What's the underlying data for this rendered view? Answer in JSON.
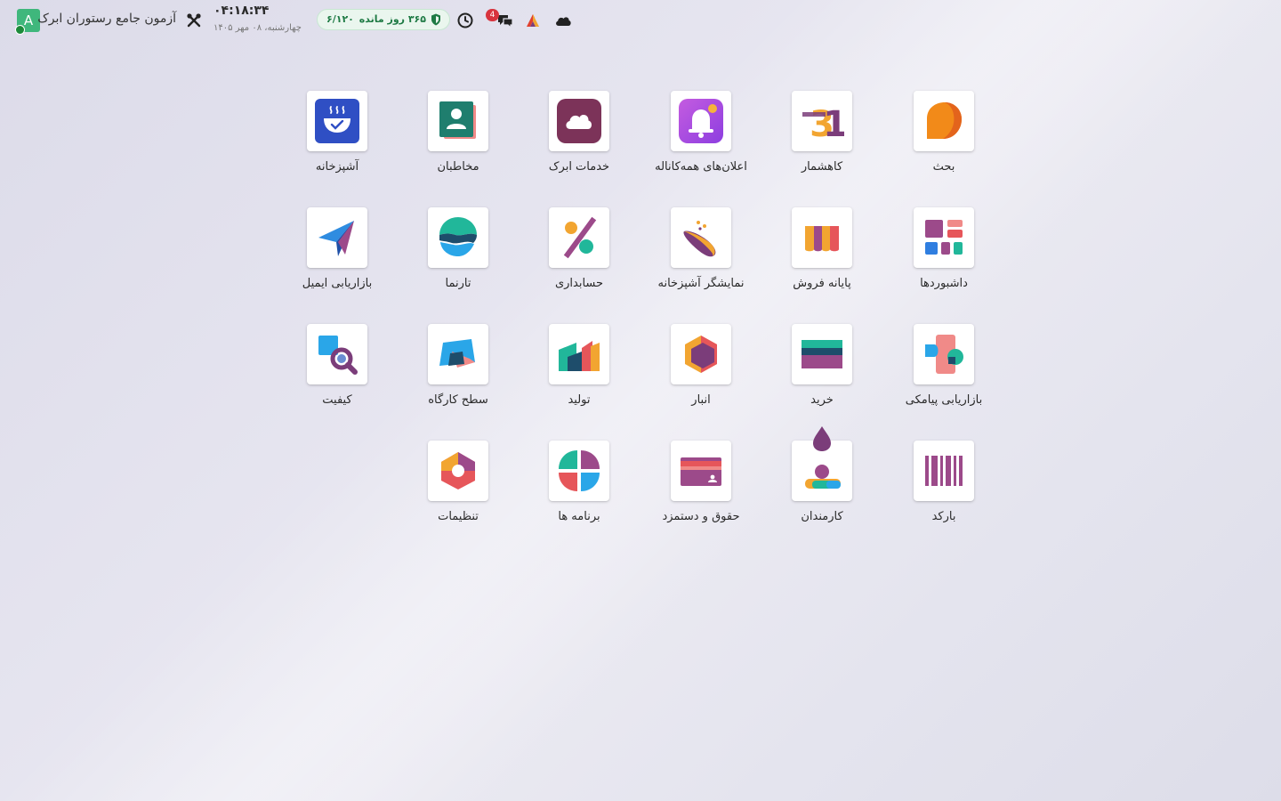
{
  "topbar": {
    "avatar_letter": "A",
    "company_name": "آزمون جامع رستوران ابرک",
    "clock_time": "۰۴:۱۸:۳۴",
    "clock_date": "چهارشنبه، ۰۸ مهر ۱۴۰۵",
    "subscription_days": "۳۶۵ روز مانده",
    "subscription_count": "۶/۱۲۰",
    "notification_count": "4",
    "icons": [
      "tools-icon",
      "shield-icon",
      "clock-icon",
      "chat-icon",
      "activity-logo-icon",
      "cloud-icon"
    ]
  },
  "apps": [
    {
      "label": "آشپزخانه",
      "icon": "kitchen-icon"
    },
    {
      "label": "مخاطبان",
      "icon": "contacts-icon"
    },
    {
      "label": "خدمات ابرک",
      "icon": "cloud-services-icon"
    },
    {
      "label": "اعلان‌های همه‌کاناله",
      "icon": "omnichannel-icon"
    },
    {
      "label": "کاهشمار",
      "icon": "calendar-icon"
    },
    {
      "label": "بحث",
      "icon": "discuss-icon"
    },
    {
      "label": "بازاریابی ایمیل",
      "icon": "email-marketing-icon"
    },
    {
      "label": "تارنما",
      "icon": "website-icon"
    },
    {
      "label": "حسابداری",
      "icon": "accounting-icon"
    },
    {
      "label": "نمایشگر آشپزخانه",
      "icon": "kitchen-display-icon"
    },
    {
      "label": "پایانه فروش",
      "icon": "pos-icon"
    },
    {
      "label": "داشبوردها",
      "icon": "dashboards-icon"
    },
    {
      "label": "کیفیت",
      "icon": "quality-icon"
    },
    {
      "label": "سطح کارگاه",
      "icon": "shop-floor-icon"
    },
    {
      "label": "تولید",
      "icon": "manufacturing-icon"
    },
    {
      "label": "انبار",
      "icon": "inventory-icon"
    },
    {
      "label": "خرید",
      "icon": "purchase-icon"
    },
    {
      "label": "بازاریابی پیامکی",
      "icon": "sms-marketing-icon"
    },
    {
      "label": "تنظیمات",
      "icon": "settings-icon"
    },
    {
      "label": "برنامه ها",
      "icon": "apps-icon"
    },
    {
      "label": "حقوق و دستمزد",
      "icon": "payroll-icon"
    },
    {
      "label": "کارمندان",
      "icon": "employees-icon"
    },
    {
      "label": "بارکد",
      "icon": "barcode-icon"
    }
  ]
}
